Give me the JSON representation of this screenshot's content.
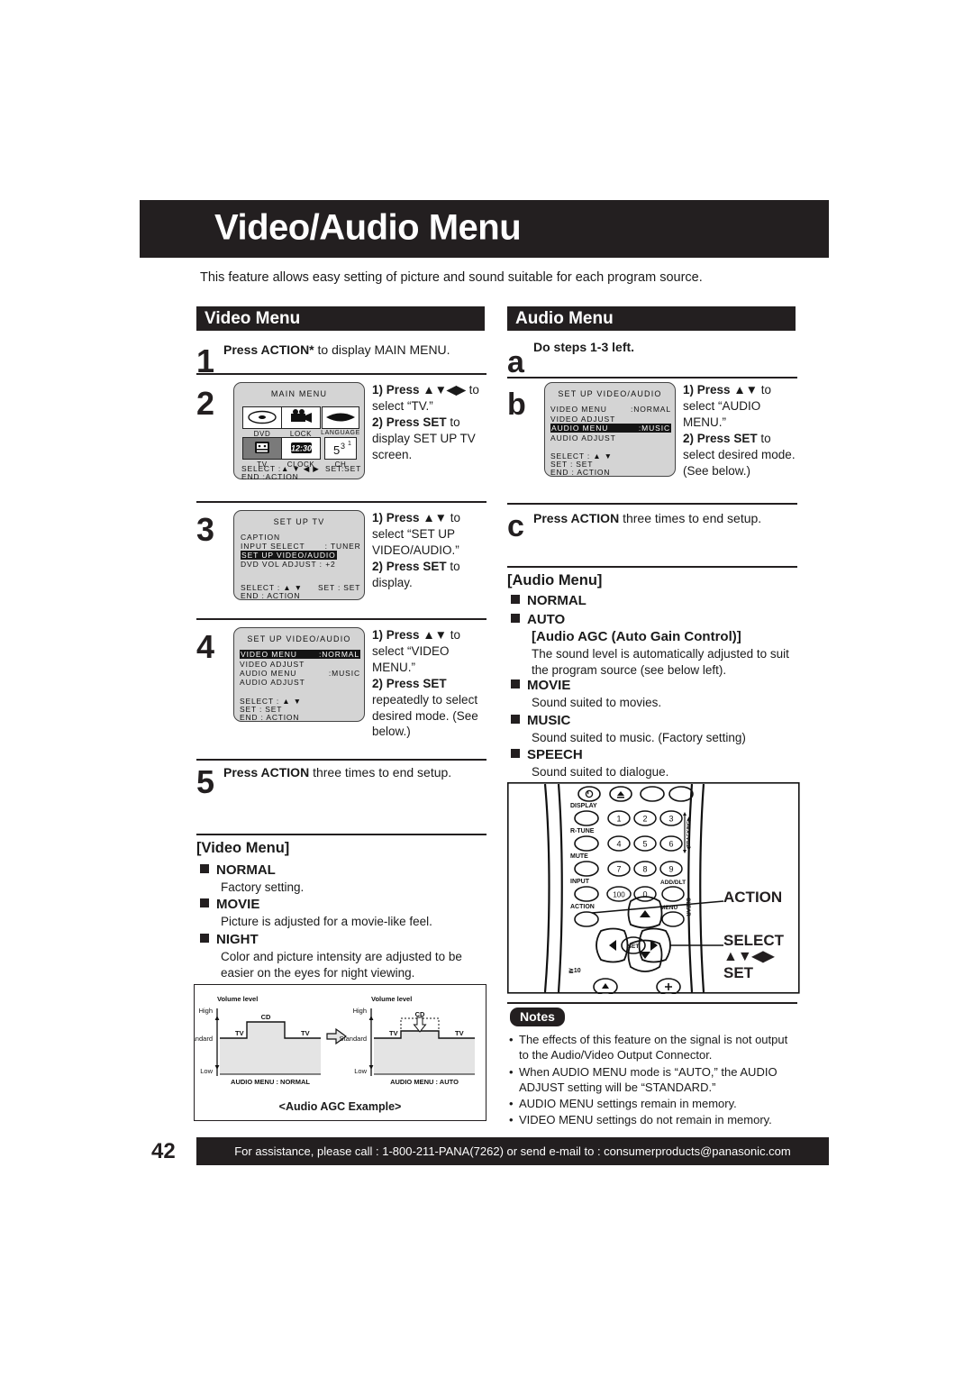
{
  "page": {
    "title": "Video/Audio Menu",
    "intro": "This feature allows easy setting of picture and sound suitable for each program source.",
    "number": "42",
    "footer": "For assistance, please call : 1-800-211-PANA(7262) or send e-mail to : consumerproducts@panasonic.com"
  },
  "video_column": {
    "header": "Video Menu",
    "steps": [
      {
        "num": "1",
        "text_html": "<b>Press ACTION*</b> to display MAIN MENU."
      },
      {
        "num": "2",
        "instructions": [
          {
            "n": "1)",
            "html": "<b>Press ▲▼◀▶</b> to select “TV.”"
          },
          {
            "n": "2)",
            "html": "<b>Press SET</b> to display SET UP TV screen."
          }
        ]
      },
      {
        "num": "3",
        "instructions": [
          {
            "n": "1)",
            "html": "<b>Press ▲▼</b> to select “SET UP VIDEO/AUDIO.”"
          },
          {
            "n": "2)",
            "html": "<b>Press SET</b> to display."
          }
        ]
      },
      {
        "num": "4",
        "instructions": [
          {
            "n": "1)",
            "html": "<b>Press ▲▼</b> to select “VIDEO MENU.”"
          },
          {
            "n": "2)",
            "html": "<b>Press SET</b> repeatedly to select desired mode. (See below.)"
          }
        ]
      },
      {
        "num": "5",
        "text_html": "<b>Press ACTION</b> three times to end setup."
      }
    ]
  },
  "audio_column": {
    "header": "Audio Menu",
    "steps": [
      {
        "num": "a",
        "text_html": "<b>Do steps 1-3 left.</b>"
      },
      {
        "num": "b",
        "instructions": [
          {
            "n": "1)",
            "html": "<b>Press ▲▼</b> to select “AUDIO MENU.”"
          },
          {
            "n": "2)",
            "html": "<b>Press SET</b> to select desired mode. (See below.)"
          }
        ]
      },
      {
        "num": "c",
        "text_html": "<b>Press ACTION</b> three times to end setup."
      }
    ]
  },
  "osd_main_menu": {
    "title": "MAIN MENU",
    "cells": [
      {
        "label": "DVD",
        "icon": "disc-icon",
        "selected": false
      },
      {
        "label": "LOCK",
        "icon": "camcorder-icon",
        "selected": false
      },
      {
        "label": "LANGUAGE",
        "icon": "lips-icon",
        "selected": false
      },
      {
        "label": "TV",
        "icon": "tv-icon",
        "selected": true
      },
      {
        "label": "CLOCK",
        "icon": "clock-icon",
        "selected": false
      },
      {
        "label": "CH",
        "icon": "channel-icon",
        "selected": false
      }
    ],
    "footer_left": "SELECT :▲ ▼ ◀ ▶",
    "footer_right": "SET:SET",
    "footer_end": "END      :ACTION"
  },
  "osd_setup_tv": {
    "title": "SET UP TV",
    "rows": [
      {
        "label": "CAPTION",
        "value": "",
        "highlight": false
      },
      {
        "label": " INPUT SELECT",
        "value": ": TUNER",
        "highlight": false
      },
      {
        "label": "SET UP VIDEO/AUDIO",
        "value": "",
        "highlight": true
      },
      {
        "label": "DVD VOL ADJUST",
        "value": " : +2",
        "highlight": false
      }
    ],
    "footer_left": "SELECT : ▲ ▼",
    "footer_right": "SET : SET",
    "footer_end": "END     : ACTION"
  },
  "osd_setup_va_video": {
    "title": "SET UP VIDEO/AUDIO",
    "rows": [
      {
        "label": "VIDEO MENU",
        "value": ":NORMAL",
        "highlight": true
      },
      {
        "label": "VIDEO ADJUST",
        "value": "",
        "highlight": false
      },
      {
        "label": "AUDIO MENU",
        "value": ":MUSIC",
        "highlight": false
      },
      {
        "label": "AUDIO ADJUST",
        "value": "",
        "highlight": false
      }
    ],
    "footer_1": "SELECT : ▲ ▼",
    "footer_2": "SET      : SET",
    "footer_3": "END      : ACTION"
  },
  "osd_setup_va_audio": {
    "title": "SET UP VIDEO/AUDIO",
    "rows": [
      {
        "label": "VIDEO MENU",
        "value": ":NORMAL",
        "highlight": false
      },
      {
        "label": "VIDEO ADJUST",
        "value": "",
        "highlight": false
      },
      {
        "label": "AUDIO MENU",
        "value": ":MUSIC",
        "highlight": true
      },
      {
        "label": "AUDIO ADJUST",
        "value": "",
        "highlight": false
      }
    ],
    "footer_1": "SELECT : ▲ ▼",
    "footer_2": "SET      : SET",
    "footer_3": "END      : ACTION"
  },
  "video_menu_list": {
    "title": "[Video Menu]",
    "items": [
      {
        "name": "NORMAL",
        "desc": "Factory setting."
      },
      {
        "name": "MOVIE",
        "desc": "Picture is adjusted for a movie-like feel."
      },
      {
        "name": "NIGHT",
        "desc": "Color and picture intensity are adjusted to be easier on the eyes for night viewing."
      }
    ]
  },
  "audio_menu_list": {
    "title": "[Audio Menu]",
    "items": [
      {
        "name": "NORMAL",
        "desc": ""
      },
      {
        "name": "AUTO",
        "subtitle": "[Audio AGC (Auto Gain Control)]",
        "desc": "The sound level is automatically adjusted to suit the program source (see below left)."
      },
      {
        "name": "MOVIE",
        "desc": "Sound suited to movies."
      },
      {
        "name": "MUSIC",
        "desc": "Sound suited to music. (Factory setting)"
      },
      {
        "name": "SPEECH",
        "desc": "Sound suited to dialogue."
      }
    ]
  },
  "agc_figure": {
    "caption": "<Audio AGC Example>",
    "left": {
      "axis_title": "Volume level",
      "ticks": [
        "High",
        "Standard",
        "Low"
      ],
      "segments": [
        "TV",
        "CD",
        "TV"
      ],
      "label": "AUDIO MENU : NORMAL"
    },
    "right": {
      "axis_title": "Volume level",
      "ticks": [
        "High",
        "Standard",
        "Low"
      ],
      "segments": [
        "TV",
        "CD",
        "TV"
      ],
      "label": "AUDIO MENU : AUTO"
    }
  },
  "remote": {
    "buttons_left": [
      "DISPLAY",
      "R-TUNE",
      "MUTE",
      "INPUT",
      "ACTION"
    ],
    "keypad": [
      "1",
      "2",
      "3",
      "4",
      "5",
      "6",
      "7",
      "8",
      "9",
      "100",
      "0"
    ],
    "add_dlt": "ADD/DLT",
    "clear": "CLEAR",
    "menu": "MENU",
    "ch_vol": "◀ TRACKING ▶",
    "gte10": "≧10",
    "callouts": [
      {
        "label": "ACTION"
      },
      {
        "label": "SELECT",
        "arrows": "▲▼◀▶",
        "sub": "SET"
      }
    ]
  },
  "notes": {
    "badge": "Notes",
    "items": [
      "The effects of this feature on the signal is not output to the Audio/Video Output Connector.",
      "When AUDIO MENU mode is “AUTO,” the AUDIO ADJUST setting will be “STANDARD.”",
      "AUDIO MENU settings remain in memory.",
      "VIDEO MENU settings do not remain in memory."
    ]
  },
  "colors": {
    "ink": "#231f20",
    "osd_bg": "#d4d4d4",
    "fill_gray": "#e4e4e4"
  }
}
